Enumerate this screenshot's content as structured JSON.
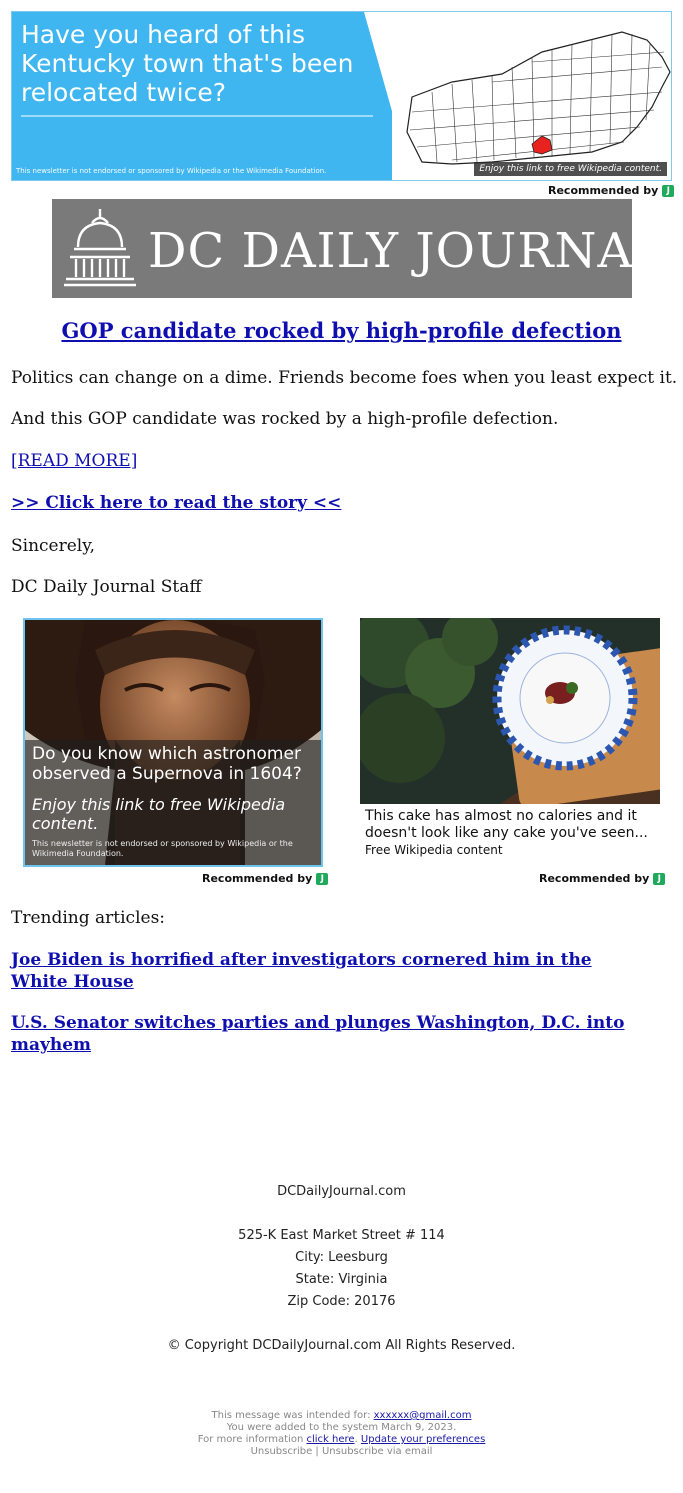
{
  "top_ad": {
    "headline": "Have you heard of this Kentucky town that's been relocated twice?",
    "disclaimer": "This newsletter is not endorsed or sponsored by Wikipedia or the Wikimedia Foundation.",
    "map_caption": "Enjoy this link to free Wikipedia content.",
    "recommended_by": "Recommended by",
    "badge": "J"
  },
  "masthead": {
    "brand": "DC DAILY JOURNAL"
  },
  "article": {
    "title": "GOP candidate rocked by high-profile defection",
    "para1": "Politics can change on a dime. Friends become foes when you least expect it.",
    "para2": "And this GOP candidate was rocked by a high-profile defection.",
    "read_more": "[READ MORE]",
    "click_here": ">> Click here to read the story <<",
    "sign_off": "Sincerely,",
    "signature": "DC Daily Journal Staff"
  },
  "ad_left": {
    "question": "Do you know which astronomer observed a Supernova in 1604?",
    "enjoy": "Enjoy this link to free Wikipedia content.",
    "disclaimer": "This newsletter is not endorsed or sponsored by Wikipedia or the Wikimedia Foundation.",
    "recommended_by": "Recommended by",
    "badge": "J"
  },
  "ad_right": {
    "text": "This cake has almost no calories and it doesn't look like any cake you've seen...",
    "sub": "Free Wikipedia content",
    "recommended_by": "Recommended by",
    "badge": "J"
  },
  "trending": {
    "label": "Trending articles:",
    "links": [
      "Joe Biden is horrified after investigators cornered him in the White House",
      "U.S. Senator switches parties and plunges Washington, D.C. into mayhem"
    ]
  },
  "footer": {
    "site": "DCDailyJournal.com",
    "street": "525-K East Market Street # 114",
    "city": "City: Leesburg",
    "state": "State: Virginia",
    "zip": "Zip Code: 20176",
    "copyright": "© Copyright DCDailyJournal.com All Rights Reserved."
  },
  "legal": {
    "intended_prefix": "This message was intended for:",
    "email": "xxxxxx@gmail.com",
    "added": "You were added to the system March 9, 2023.",
    "more_info_prefix": "For more information",
    "click_here": "click here",
    "update_prefs": "Update your preferences",
    "unsubscribe": "Unsubscribe",
    "separator": "|",
    "unsubscribe_email": "Unsubscribe via email"
  }
}
